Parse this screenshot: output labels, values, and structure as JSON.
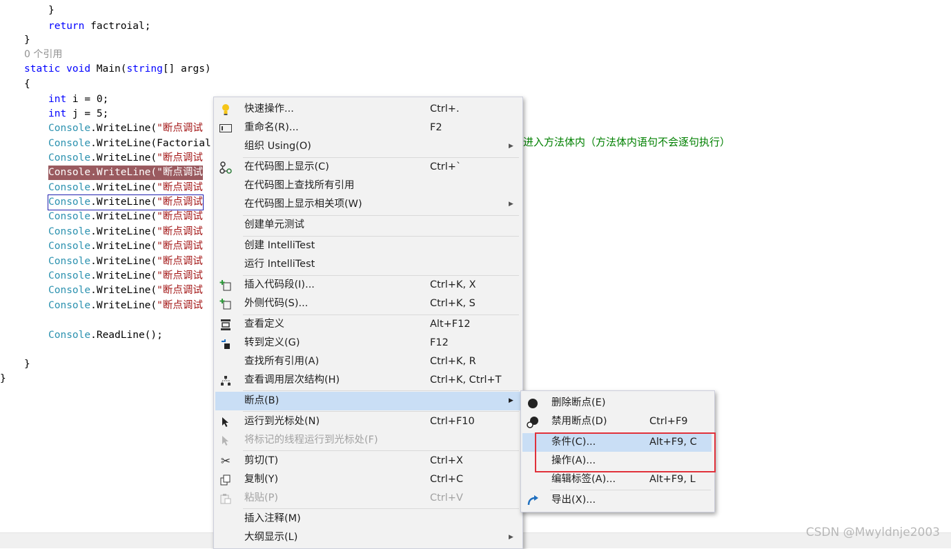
{
  "code": {
    "lines": [
      "}",
      "return",
      " factroial;",
      "}",
      "0 个引用",
      "static",
      "void",
      " Main(",
      "string",
      "[] args)",
      "{",
      "int",
      " i = 0;",
      "int",
      " j = 5;",
      "Console",
      ".WriteLine(",
      "\"断点调试",
      ".WriteLine(Factorial",
      ".ReadLine();",
      "进入方法体内（方法体内语句不会逐句执行）"
    ]
  },
  "context_menu": {
    "items": [
      {
        "label": "快速操作...",
        "shortcut": "Ctrl+.",
        "icon": "lightbulb-icon"
      },
      {
        "label": "重命名(R)...",
        "shortcut": "F2",
        "icon": "rename-icon"
      },
      {
        "label": "组织 Using(O)",
        "shortcut": "",
        "icon": ""
      },
      {
        "label": "在代码图上显示(C)",
        "shortcut": "Ctrl+`",
        "icon": "code-map-icon"
      },
      {
        "label": "在代码图上查找所有引用",
        "shortcut": "",
        "icon": ""
      },
      {
        "label": "在代码图上显示相关项(W)",
        "shortcut": "",
        "icon": ""
      },
      {
        "label": "创建单元测试",
        "shortcut": "",
        "icon": ""
      },
      {
        "label": "创建 IntelliTest",
        "shortcut": "",
        "icon": ""
      },
      {
        "label": "运行 IntelliTest",
        "shortcut": "",
        "icon": ""
      },
      {
        "label": "插入代码段(I)...",
        "shortcut": "Ctrl+K, X",
        "icon": "insert-snippet-icon"
      },
      {
        "label": "外侧代码(S)...",
        "shortcut": "Ctrl+K, S",
        "icon": "surround-with-icon"
      },
      {
        "label": "查看定义",
        "shortcut": "Alt+F12",
        "icon": "peek-definition-icon"
      },
      {
        "label": "转到定义(G)",
        "shortcut": "F12",
        "icon": "go-to-definition-icon"
      },
      {
        "label": "查找所有引用(A)",
        "shortcut": "Ctrl+K, R",
        "icon": ""
      },
      {
        "label": "查看调用层次结构(H)",
        "shortcut": "Ctrl+K, Ctrl+T",
        "icon": "call-hierarchy-icon"
      },
      {
        "label": "断点(B)",
        "shortcut": "",
        "icon": ""
      },
      {
        "label": "运行到光标处(N)",
        "shortcut": "Ctrl+F10",
        "icon": "cursor-icon"
      },
      {
        "label": "将标记的线程运行到光标处(F)",
        "shortcut": "",
        "icon": "cursor-icon"
      },
      {
        "label": "剪切(T)",
        "shortcut": "Ctrl+X",
        "icon": "cut-icon"
      },
      {
        "label": "复制(Y)",
        "shortcut": "Ctrl+C",
        "icon": "copy-icon"
      },
      {
        "label": "粘贴(P)",
        "shortcut": "Ctrl+V",
        "icon": "paste-icon"
      },
      {
        "label": "插入注释(M)",
        "shortcut": "",
        "icon": ""
      },
      {
        "label": "大纲显示(L)",
        "shortcut": "",
        "icon": ""
      }
    ]
  },
  "submenu": {
    "items": [
      {
        "label": "删除断点(E)",
        "shortcut": "",
        "icon": "breakpoint-icon"
      },
      {
        "label": "禁用断点(D)",
        "shortcut": "Ctrl+F9",
        "icon": "disable-breakpoint-icon"
      },
      {
        "label": "条件(C)...",
        "shortcut": "Alt+F9, C",
        "icon": ""
      },
      {
        "label": "操作(A)...",
        "shortcut": "",
        "icon": ""
      },
      {
        "label": "编辑标签(A)...",
        "shortcut": "Alt+F9, L",
        "icon": ""
      },
      {
        "label": "导出(X)...",
        "shortcut": "",
        "icon": "export-icon"
      }
    ]
  },
  "watermark": "CSDN @Mwyldnje2003",
  "colors": {
    "menu_bg": "#f2f2f2",
    "highlight": "#c9def5",
    "breakpoint_line": "#9a5a5f",
    "annotation_box": "#e0303a"
  }
}
